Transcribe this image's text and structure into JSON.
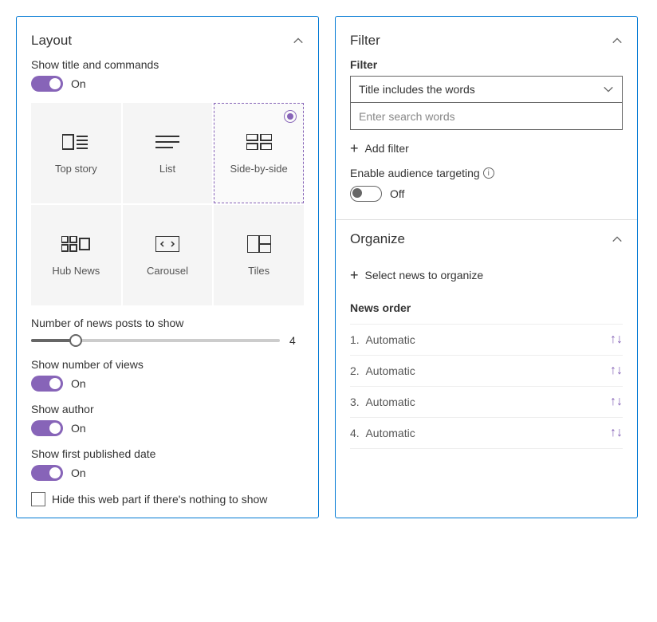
{
  "layout": {
    "title": "Layout",
    "show_title_commands": {
      "label": "Show title and commands",
      "state": "On"
    },
    "tiles": [
      {
        "id": "top-story",
        "label": "Top story"
      },
      {
        "id": "list",
        "label": "List"
      },
      {
        "id": "side-by-side",
        "label": "Side-by-side",
        "selected": true
      },
      {
        "id": "hub-news",
        "label": "Hub News"
      },
      {
        "id": "carousel",
        "label": "Carousel"
      },
      {
        "id": "tiles",
        "label": "Tiles"
      }
    ],
    "posts_slider": {
      "label": "Number of news posts to show",
      "value": "4",
      "percent": 18
    },
    "show_views": {
      "label": "Show number of views",
      "state": "On"
    },
    "show_author": {
      "label": "Show author",
      "state": "On"
    },
    "show_date": {
      "label": "Show first published date",
      "state": "On"
    },
    "hide_empty": {
      "label": "Hide this web part if there's nothing to show"
    }
  },
  "filter": {
    "title": "Filter",
    "field_label": "Filter",
    "select_value": "Title includes the words",
    "input_placeholder": "Enter search words",
    "add_filter": "Add filter",
    "targeting": {
      "label": "Enable audience targeting",
      "state": "Off"
    }
  },
  "organize": {
    "title": "Organize",
    "select_news": "Select news to organize",
    "order_label": "News order",
    "items": [
      {
        "num": "1.",
        "text": "Automatic"
      },
      {
        "num": "2.",
        "text": "Automatic"
      },
      {
        "num": "3.",
        "text": "Automatic"
      },
      {
        "num": "4.",
        "text": "Automatic"
      }
    ]
  }
}
